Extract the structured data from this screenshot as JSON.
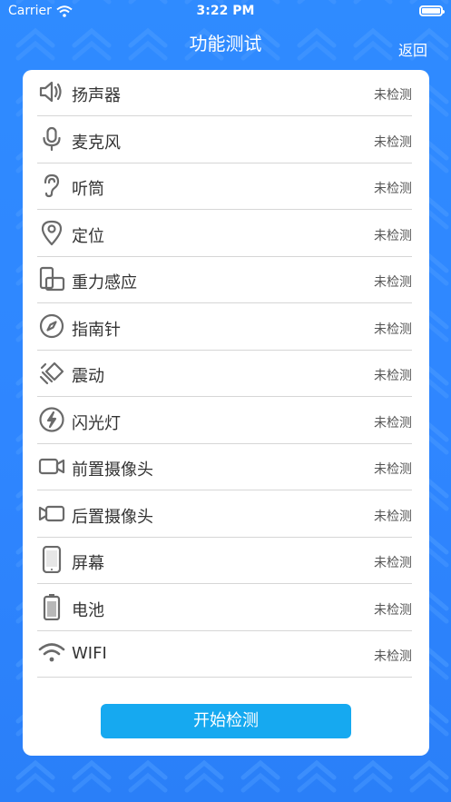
{
  "status_bar": {
    "carrier": "Carrier",
    "time": "3:22 PM"
  },
  "nav": {
    "title": "功能测试",
    "back_label": "返回"
  },
  "items": [
    {
      "label": "扬声器",
      "status": "未检测",
      "icon": "speaker-icon"
    },
    {
      "label": "麦克风",
      "status": "未检测",
      "icon": "microphone-icon"
    },
    {
      "label": "听筒",
      "status": "未检测",
      "icon": "ear-icon"
    },
    {
      "label": "定位",
      "status": "未检测",
      "icon": "location-pin-icon"
    },
    {
      "label": "重力感应",
      "status": "未检测",
      "icon": "gravity-sensor-icon"
    },
    {
      "label": "指南针",
      "status": "未检测",
      "icon": "compass-icon"
    },
    {
      "label": "震动",
      "status": "未检测",
      "icon": "vibration-icon"
    },
    {
      "label": "闪光灯",
      "status": "未检测",
      "icon": "flash-icon"
    },
    {
      "label": "前置摄像头",
      "status": "未检测",
      "icon": "front-camera-icon"
    },
    {
      "label": "后置摄像头",
      "status": "未检测",
      "icon": "rear-camera-icon"
    },
    {
      "label": "屏幕",
      "status": "未检测",
      "icon": "phone-screen-icon"
    },
    {
      "label": "电池",
      "status": "未检测",
      "icon": "battery-icon"
    },
    {
      "label": "WIFI",
      "status": "未检测",
      "icon": "wifi-icon"
    }
  ],
  "start_button_label": "开始检测",
  "colors": {
    "background": "#2f8bff",
    "button": "#16a9f0",
    "icon_gray": "#6a6a6a"
  }
}
